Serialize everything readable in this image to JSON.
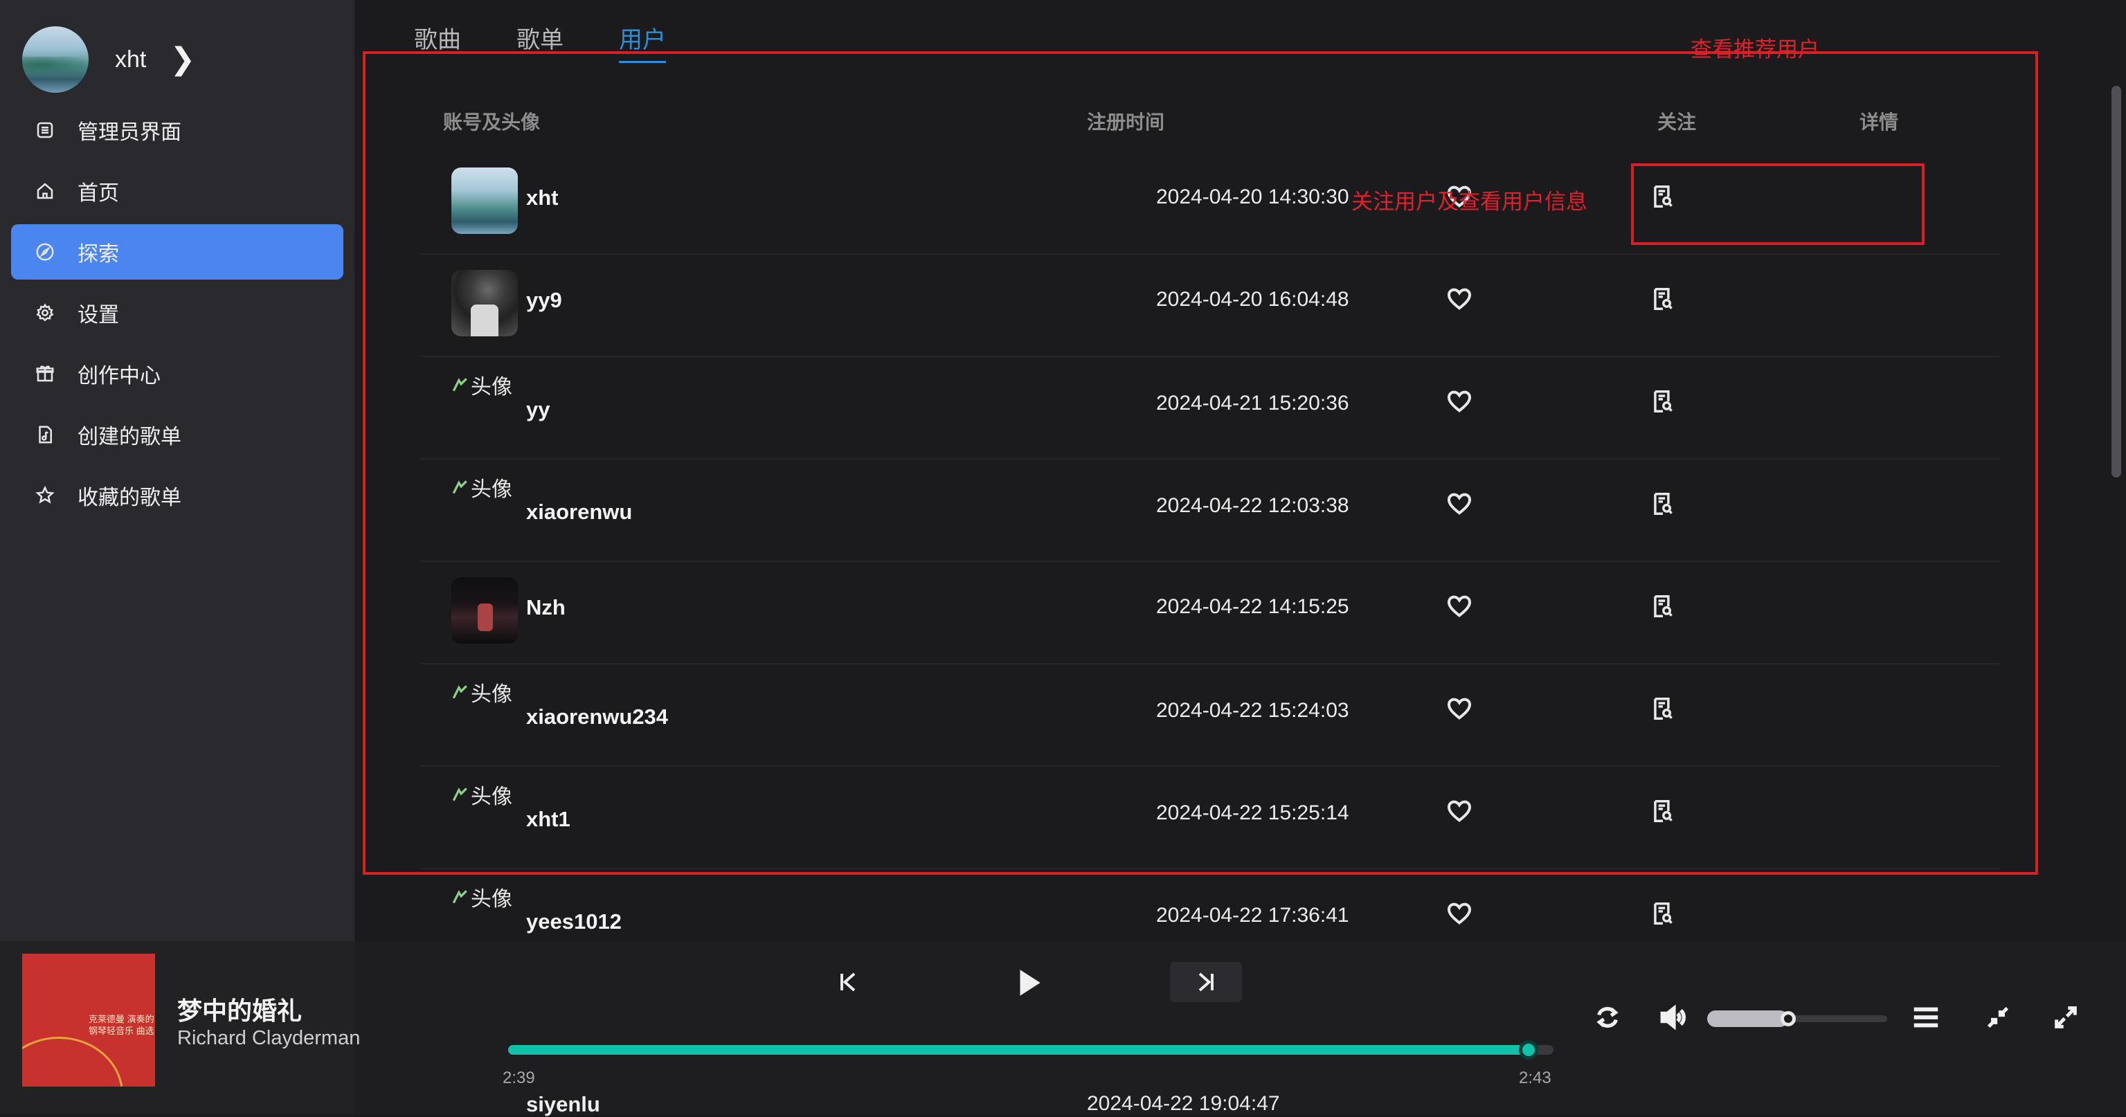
{
  "sidebar": {
    "user_name": "xht",
    "nav": [
      {
        "label": "管理员界面",
        "icon": "list-icon"
      },
      {
        "label": "首页",
        "icon": "home-icon"
      },
      {
        "label": "探索",
        "icon": "compass-icon",
        "active": true
      },
      {
        "label": "设置",
        "icon": "gear-icon"
      },
      {
        "label": "创作中心",
        "icon": "gift-icon"
      },
      {
        "label": "创建的歌单",
        "icon": "music-file-icon"
      },
      {
        "label": "收藏的歌单",
        "icon": "star-icon"
      }
    ]
  },
  "tabs": [
    {
      "label": "歌曲"
    },
    {
      "label": "歌单"
    },
    {
      "label": "用户",
      "active": true
    }
  ],
  "table": {
    "headers": {
      "account": "账号及头像",
      "registered": "注册时间",
      "follow": "关注",
      "detail": "详情"
    },
    "broken_avatar_alt": "头像",
    "rows": [
      {
        "name": "xht",
        "date": "2024-04-20 14:30:30",
        "avatar": "landscape"
      },
      {
        "name": "yy9",
        "date": "2024-04-20 16:04:48",
        "avatar": "portrait"
      },
      {
        "name": "yy",
        "date": "2024-04-21 15:20:36",
        "avatar": "broken"
      },
      {
        "name": "xiaorenwu",
        "date": "2024-04-22 12:03:38",
        "avatar": "broken"
      },
      {
        "name": "Nzh",
        "date": "2024-04-22 14:15:25",
        "avatar": "stage"
      },
      {
        "name": "xiaorenwu234",
        "date": "2024-04-22 15:24:03",
        "avatar": "broken"
      },
      {
        "name": "xht1",
        "date": "2024-04-22 15:25:14",
        "avatar": "broken"
      },
      {
        "name": "yees1012",
        "date": "2024-04-22 17:36:41",
        "avatar": "broken"
      }
    ],
    "partial_row": {
      "name": "siyenlu",
      "date": "2024-04-22 19:04:47"
    }
  },
  "annotations": {
    "view_recommended": "查看推荐用户",
    "follow_and_view": "关注用户及查看用户信息",
    "color": "#d81f26"
  },
  "player": {
    "song_title": "梦中的婚礼",
    "artist": "Richard Clayderman",
    "cover_text": "克莱德曼 演奏的 钢琴轻音乐 曲选",
    "elapsed": "2:39",
    "duration": "2:43",
    "progress_fraction": 0.976,
    "volume_fraction": 0.45,
    "accent_color": "#10c2ac"
  },
  "colors": {
    "active_nav": "#4b86f0",
    "active_tab": "#2d8fd8"
  }
}
